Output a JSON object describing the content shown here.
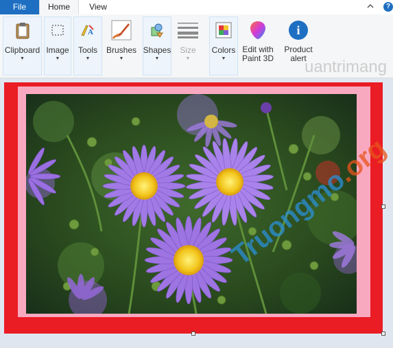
{
  "tabs": [
    {
      "label": "File"
    },
    {
      "label": "Home"
    },
    {
      "label": "View"
    }
  ],
  "ribbon": {
    "clipboard": "Clipboard",
    "image": "Image",
    "tools": "Tools",
    "brushes": "Brushes",
    "shapes": "Shapes",
    "size": "Size",
    "colors": "Colors",
    "edit3d_line1": "Edit with",
    "edit3d_line2": "Paint 3D",
    "product_line1": "Product",
    "product_line2": "alert",
    "info_glyph": "i"
  },
  "help_glyph": "?",
  "watermark_top": "uantrimang",
  "watermark_bottom": "Truongmo",
  "watermark_bottom_tail": ".org",
  "colors": {
    "accent": "#1e6fc2",
    "frame_red": "#ea1c24",
    "frame_pink": "#f8a9c0",
    "flower_purple": "#9a6fe0"
  }
}
